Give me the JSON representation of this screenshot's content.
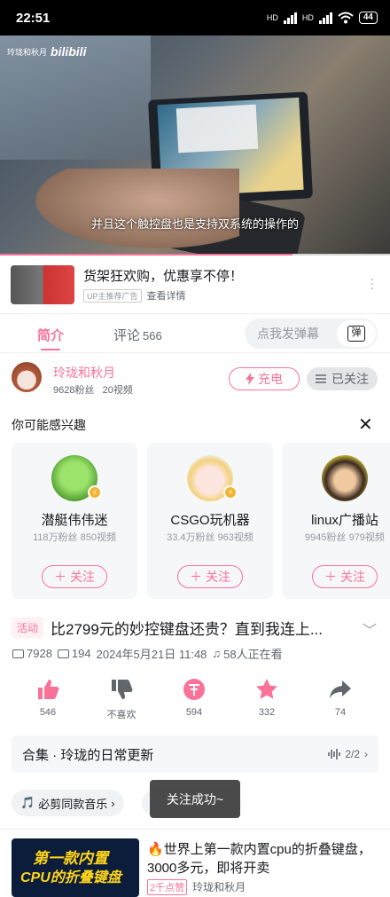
{
  "status": {
    "time": "22:51",
    "battery": "44",
    "net1": "HD",
    "net2": "HD"
  },
  "video": {
    "watermark_user": "玲珑和秋月",
    "watermark_brand": "bilibili",
    "subtitle": "并且这个触控盘也是支持双系统的操作的",
    "progress": 0.75
  },
  "ad": {
    "title": "货架狂欢购，优惠享不停！",
    "tag": "UP主推荐广告",
    "link": "查看详情",
    "more_icon": "more-vertical-icon"
  },
  "tabs": {
    "intro": "简介",
    "comments": "评论",
    "comments_count": "566",
    "danmaku_placeholder": "点我发弹幕",
    "danmaku_icon": "弹"
  },
  "uploader": {
    "name": "玲珑和秋月",
    "fans": "9628粉丝",
    "videos": "20视频",
    "charge_label": "充电",
    "followed_label": "已关注"
  },
  "recommend": {
    "title": "你可能感兴趣",
    "cards": [
      {
        "name": "潜艇伟伟迷",
        "stats": "118万粉丝 850视频",
        "follow": "关注",
        "color": "#79c94a"
      },
      {
        "name": "CSGO玩机器",
        "stats": "33.4万粉丝 963视频",
        "follow": "关注",
        "color": "#f6e2a8"
      },
      {
        "name": "linux广播站",
        "stats": "9945粉丝 979视频",
        "follow": "关注",
        "color": "#c9c14a"
      }
    ]
  },
  "video_info": {
    "tag": "活动",
    "title": "比2799元的妙控键盘还贵？直到我连上...",
    "views": "7928",
    "danmaku": "194",
    "date": "2024年5月21日 11:48",
    "watching": "58人正在看"
  },
  "actions": [
    {
      "label": "546",
      "icon": "thumbs-up-icon"
    },
    {
      "label": "不喜欢",
      "icon": "thumbs-down-icon"
    },
    {
      "label": "594",
      "icon": "coin-icon"
    },
    {
      "label": "332",
      "icon": "star-icon"
    },
    {
      "label": "74",
      "icon": "share-icon"
    }
  ],
  "collection": {
    "label": "合集 · 玲珑的日常更新",
    "count": "2/2"
  },
  "chips": {
    "music": "必剪同款音乐",
    "toast": "关注成功~"
  },
  "related": {
    "thumb_line1": "第一款内置",
    "thumb_line2": "CPU的折叠键盘",
    "title": "🔥世界上第一款内置cpu的折叠键盘，3000多元，即将开卖",
    "tag": "2千点赞",
    "author": "玲珑和秋月"
  },
  "colors": {
    "accent": "#fb7299"
  }
}
